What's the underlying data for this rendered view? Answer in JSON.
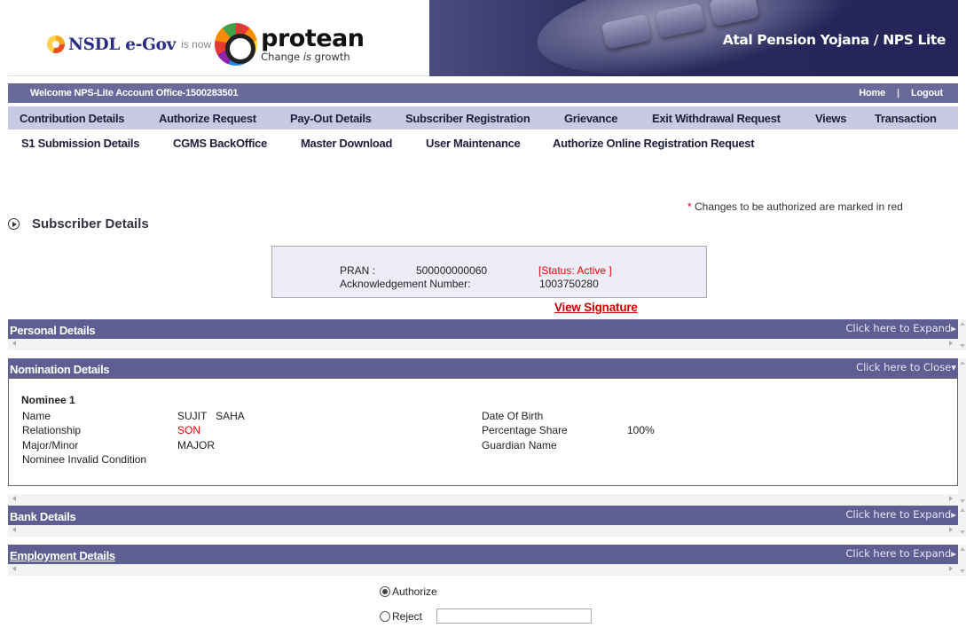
{
  "header": {
    "nsdl_text": "NSDL e-Gov",
    "is_now": "is now",
    "protean_name": "protean",
    "protean_tag_pre": "Change ",
    "protean_tag_em": "is",
    "protean_tag_post": " growth",
    "banner_title": "Atal Pension Yojana / NPS Lite"
  },
  "welcome": {
    "message": "Welcome NPS-Lite Account Office-1500283501",
    "home": "Home",
    "separator": "|",
    "logout": "Logout"
  },
  "menu_primary": [
    "Contribution Details",
    "Authorize Request",
    "Pay-Out Details",
    "Subscriber Registration",
    "Grievance",
    "Exit Withdrawal Request",
    "Views",
    "Transaction"
  ],
  "menu_secondary": [
    "S1 Submission Details",
    "CGMS BackOffice",
    "Master Download",
    "User Maintenance",
    "Authorize Online Registration Request"
  ],
  "note": {
    "star": "*",
    "text": " Changes to be authorized are marked in red"
  },
  "section_title": "Subscriber Details",
  "pran": {
    "pran_label": "PRAN :",
    "pran_value": "500000000060",
    "status": "[Status: Active ]",
    "ack_label": "Acknowledgement Number:",
    "ack_value": "1003750280"
  },
  "view_signature": "View Signature",
  "panels": {
    "personal": {
      "title": "Personal Details",
      "action": "Click here to Expand"
    },
    "nomination": {
      "title": "Nomination Details",
      "action": "Click here to Close"
    },
    "bank": {
      "title": "Bank Details",
      "action": "Click here to Expand"
    },
    "employment": {
      "title": "Employment Details",
      "action": "Click here to Expand"
    }
  },
  "nominee": {
    "heading": "Nominee 1",
    "name_label": "Name",
    "name_value": "SUJIT   SAHA",
    "relationship_label": "Relationship",
    "relationship_value": "SON",
    "major_minor_label": "Major/Minor",
    "major_minor_value": "MAJOR",
    "invalid_label": "Nominee Invalid Condition",
    "dob_label": "Date Of Birth",
    "share_label": "Percentage Share",
    "share_value": "100%",
    "guardian_label": "Guardian Name"
  },
  "decision": {
    "authorize": "Authorize",
    "reject": "Reject",
    "selected": "Authorize",
    "reject_reason_value": ""
  },
  "colors": {
    "banner": "#2a2a5a",
    "welcome_bar": "#6a6a9a",
    "menu_bar": "#c9c9e3",
    "panel_header": "#5e5e93",
    "highlight_red": "#e00000"
  }
}
